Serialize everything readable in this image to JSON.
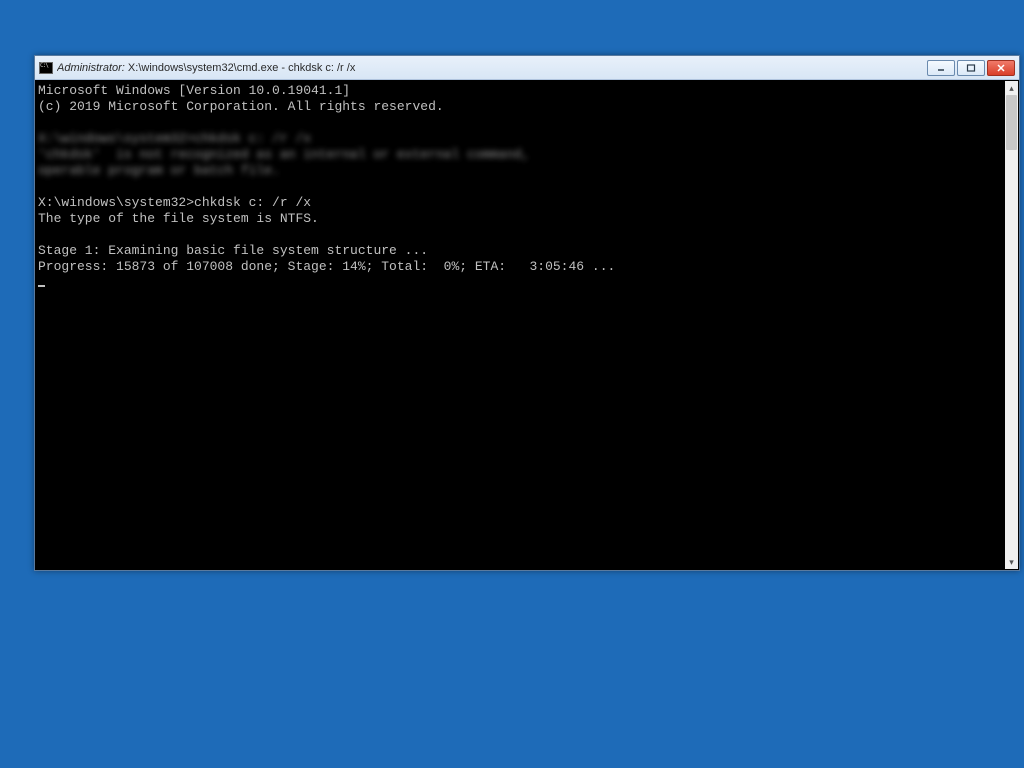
{
  "titlebar": {
    "prefix": "Administrator: ",
    "path": "X:\\windows\\system32\\cmd.exe - chkdsk  c: /r /x"
  },
  "terminal": {
    "line1": "Microsoft Windows [Version 10.0.19041.1]",
    "line2": "(c) 2019 Microsoft Corporation. All rights reserved.",
    "blurred1": "X:\\windows\\system32>chkdsk c: /r /x",
    "blurred2": "'chkdsk'  is not recognized as an internal or external command,",
    "blurred3": "operable program or batch file.",
    "prompt": "X:\\windows\\system32>chkdsk c: /r /x",
    "fs_type": "The type of the file system is NTFS.",
    "stage": "Stage 1: Examining basic file system structure ...",
    "progress": "Progress: 15873 of 107008 done; Stage: 14%; Total:  0%; ETA:   3:05:46 ..."
  }
}
